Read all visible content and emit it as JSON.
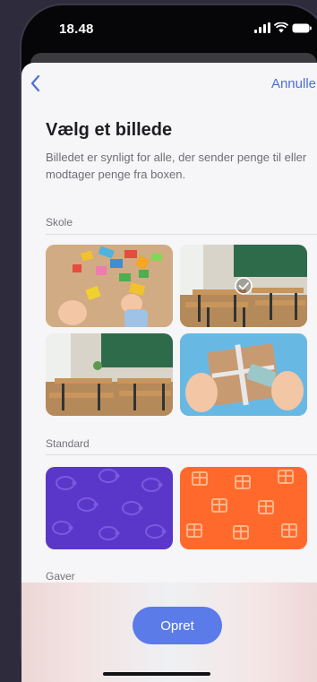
{
  "status_bar": {
    "time": "18.48"
  },
  "nav": {
    "cancel_label": "Annuller"
  },
  "header": {
    "title": "Vælg et billede",
    "subtitle": "Billedet er synligt for alle, der sender penge til eller modtager penge fra boxen."
  },
  "sections": [
    {
      "label": "Skole"
    },
    {
      "label": "Standard"
    },
    {
      "label": "Gaver"
    }
  ],
  "tiles": {
    "skole": [
      "toy-blocks-image",
      "classroom-image-selected",
      "classroom-image",
      "gift-box-hands-image"
    ],
    "standard": [
      "purple-piggy-bank-pattern",
      "orange-gift-pattern"
    ]
  },
  "selected_tile": "classroom-image-selected",
  "footer": {
    "create_label": "Opret"
  },
  "colors": {
    "accent": "#5a7be8",
    "link": "#4a6fd9",
    "purple": "#5a37c9",
    "orange": "#ff6a2c"
  }
}
